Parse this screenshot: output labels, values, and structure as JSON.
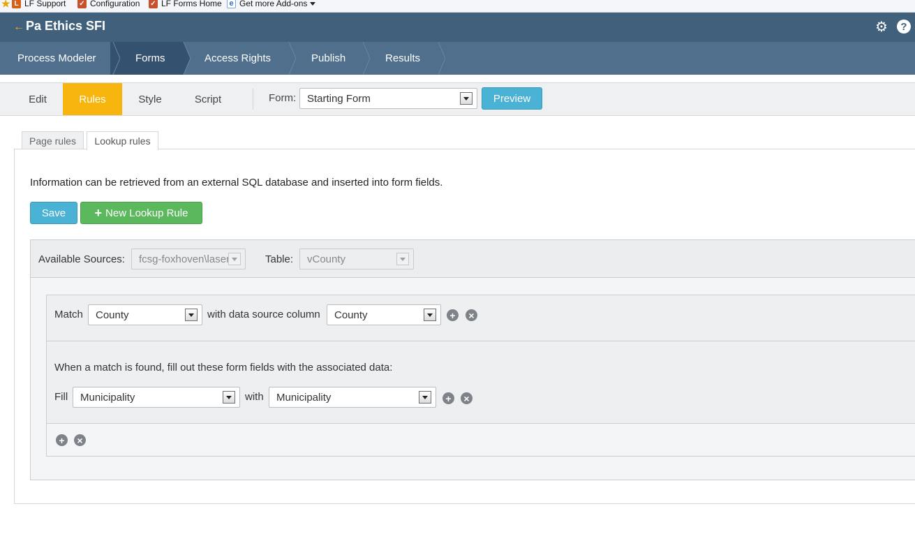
{
  "bookmarks": [
    {
      "label": "LF Support"
    },
    {
      "label": "Configuration"
    },
    {
      "label": "LF Forms Home"
    },
    {
      "label": "Get more Add-ons"
    }
  ],
  "header": {
    "title": "Pa Ethics SFI",
    "back_icon": "←",
    "gear_icon": "⚙",
    "help_icon": "?"
  },
  "nav": {
    "items": [
      {
        "label": "Process Modeler"
      },
      {
        "label": "Forms"
      },
      {
        "label": "Access Rights"
      },
      {
        "label": "Publish"
      },
      {
        "label": "Results"
      }
    ],
    "active": "Forms"
  },
  "toolbar": {
    "tabs": [
      {
        "label": "Edit"
      },
      {
        "label": "Rules"
      },
      {
        "label": "Style"
      },
      {
        "label": "Script"
      }
    ],
    "active_tab": "Rules",
    "form_label": "Form:",
    "form_value": "Starting Form",
    "preview_label": "Preview"
  },
  "subtabs": {
    "page_rules": "Page rules",
    "lookup_rules": "Lookup rules",
    "active": "Lookup rules"
  },
  "lookup": {
    "info": "Information can be retrieved from an external SQL database and inserted into form fields.",
    "save_label": "Save",
    "new_rule_label": "New Lookup Rule",
    "new_rule_icon": "+",
    "available_sources_label": "Available Sources:",
    "available_sources_value": "fcsg-foxhoven\\laserfiche",
    "table_label": "Table:",
    "table_value": "vCounty",
    "match_label": "Match",
    "match_field": "County",
    "with_column_label": "with data source column",
    "match_column": "County",
    "fill_intro": "When a match is found, fill out these form fields with the associated data:",
    "fill_label": "Fill",
    "fill_field": "Municipality",
    "with_label": "with",
    "fill_column": "Municipality",
    "add_icon": "+",
    "remove_icon": "×"
  },
  "colors": {
    "header": "#40607c",
    "nav": "#4f6f8d",
    "nav_active": "#34526f",
    "accent_tab": "#f7b50d",
    "preview_button": "#4ab2d4",
    "new_rule_button": "#5cb85c"
  }
}
